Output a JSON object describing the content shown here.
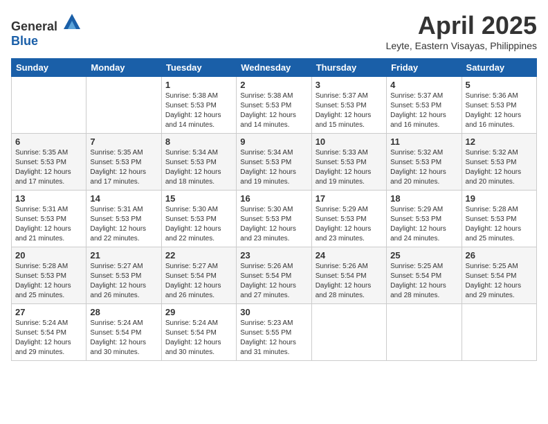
{
  "header": {
    "logo_general": "General",
    "logo_blue": "Blue",
    "month_year": "April 2025",
    "location": "Leyte, Eastern Visayas, Philippines"
  },
  "weekdays": [
    "Sunday",
    "Monday",
    "Tuesday",
    "Wednesday",
    "Thursday",
    "Friday",
    "Saturday"
  ],
  "weeks": [
    [
      {
        "day": "",
        "info": ""
      },
      {
        "day": "",
        "info": ""
      },
      {
        "day": "1",
        "info": "Sunrise: 5:38 AM\nSunset: 5:53 PM\nDaylight: 12 hours\nand 14 minutes."
      },
      {
        "day": "2",
        "info": "Sunrise: 5:38 AM\nSunset: 5:53 PM\nDaylight: 12 hours\nand 14 minutes."
      },
      {
        "day": "3",
        "info": "Sunrise: 5:37 AM\nSunset: 5:53 PM\nDaylight: 12 hours\nand 15 minutes."
      },
      {
        "day": "4",
        "info": "Sunrise: 5:37 AM\nSunset: 5:53 PM\nDaylight: 12 hours\nand 16 minutes."
      },
      {
        "day": "5",
        "info": "Sunrise: 5:36 AM\nSunset: 5:53 PM\nDaylight: 12 hours\nand 16 minutes."
      }
    ],
    [
      {
        "day": "6",
        "info": "Sunrise: 5:35 AM\nSunset: 5:53 PM\nDaylight: 12 hours\nand 17 minutes."
      },
      {
        "day": "7",
        "info": "Sunrise: 5:35 AM\nSunset: 5:53 PM\nDaylight: 12 hours\nand 17 minutes."
      },
      {
        "day": "8",
        "info": "Sunrise: 5:34 AM\nSunset: 5:53 PM\nDaylight: 12 hours\nand 18 minutes."
      },
      {
        "day": "9",
        "info": "Sunrise: 5:34 AM\nSunset: 5:53 PM\nDaylight: 12 hours\nand 19 minutes."
      },
      {
        "day": "10",
        "info": "Sunrise: 5:33 AM\nSunset: 5:53 PM\nDaylight: 12 hours\nand 19 minutes."
      },
      {
        "day": "11",
        "info": "Sunrise: 5:32 AM\nSunset: 5:53 PM\nDaylight: 12 hours\nand 20 minutes."
      },
      {
        "day": "12",
        "info": "Sunrise: 5:32 AM\nSunset: 5:53 PM\nDaylight: 12 hours\nand 20 minutes."
      }
    ],
    [
      {
        "day": "13",
        "info": "Sunrise: 5:31 AM\nSunset: 5:53 PM\nDaylight: 12 hours\nand 21 minutes."
      },
      {
        "day": "14",
        "info": "Sunrise: 5:31 AM\nSunset: 5:53 PM\nDaylight: 12 hours\nand 22 minutes."
      },
      {
        "day": "15",
        "info": "Sunrise: 5:30 AM\nSunset: 5:53 PM\nDaylight: 12 hours\nand 22 minutes."
      },
      {
        "day": "16",
        "info": "Sunrise: 5:30 AM\nSunset: 5:53 PM\nDaylight: 12 hours\nand 23 minutes."
      },
      {
        "day": "17",
        "info": "Sunrise: 5:29 AM\nSunset: 5:53 PM\nDaylight: 12 hours\nand 23 minutes."
      },
      {
        "day": "18",
        "info": "Sunrise: 5:29 AM\nSunset: 5:53 PM\nDaylight: 12 hours\nand 24 minutes."
      },
      {
        "day": "19",
        "info": "Sunrise: 5:28 AM\nSunset: 5:53 PM\nDaylight: 12 hours\nand 25 minutes."
      }
    ],
    [
      {
        "day": "20",
        "info": "Sunrise: 5:28 AM\nSunset: 5:53 PM\nDaylight: 12 hours\nand 25 minutes."
      },
      {
        "day": "21",
        "info": "Sunrise: 5:27 AM\nSunset: 5:53 PM\nDaylight: 12 hours\nand 26 minutes."
      },
      {
        "day": "22",
        "info": "Sunrise: 5:27 AM\nSunset: 5:54 PM\nDaylight: 12 hours\nand 26 minutes."
      },
      {
        "day": "23",
        "info": "Sunrise: 5:26 AM\nSunset: 5:54 PM\nDaylight: 12 hours\nand 27 minutes."
      },
      {
        "day": "24",
        "info": "Sunrise: 5:26 AM\nSunset: 5:54 PM\nDaylight: 12 hours\nand 28 minutes."
      },
      {
        "day": "25",
        "info": "Sunrise: 5:25 AM\nSunset: 5:54 PM\nDaylight: 12 hours\nand 28 minutes."
      },
      {
        "day": "26",
        "info": "Sunrise: 5:25 AM\nSunset: 5:54 PM\nDaylight: 12 hours\nand 29 minutes."
      }
    ],
    [
      {
        "day": "27",
        "info": "Sunrise: 5:24 AM\nSunset: 5:54 PM\nDaylight: 12 hours\nand 29 minutes."
      },
      {
        "day": "28",
        "info": "Sunrise: 5:24 AM\nSunset: 5:54 PM\nDaylight: 12 hours\nand 30 minutes."
      },
      {
        "day": "29",
        "info": "Sunrise: 5:24 AM\nSunset: 5:54 PM\nDaylight: 12 hours\nand 30 minutes."
      },
      {
        "day": "30",
        "info": "Sunrise: 5:23 AM\nSunset: 5:55 PM\nDaylight: 12 hours\nand 31 minutes."
      },
      {
        "day": "",
        "info": ""
      },
      {
        "day": "",
        "info": ""
      },
      {
        "day": "",
        "info": ""
      }
    ]
  ]
}
